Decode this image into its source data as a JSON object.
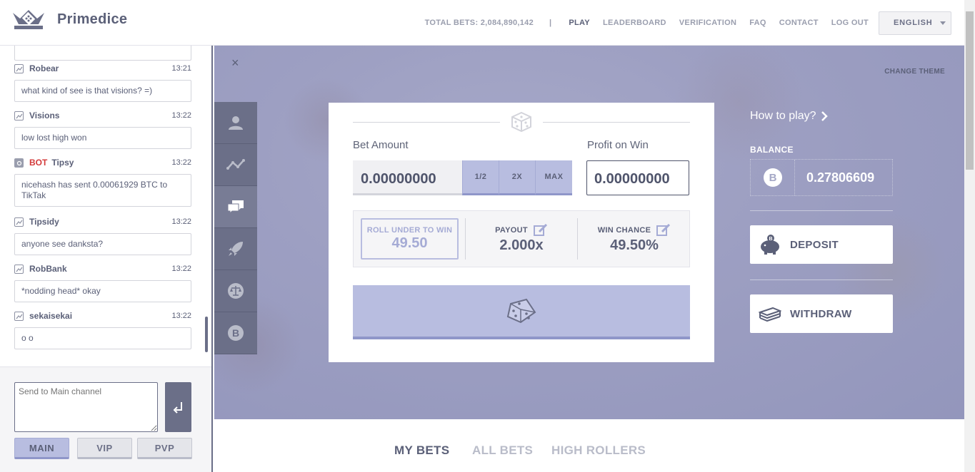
{
  "header": {
    "brand": "Primedice",
    "total_bets": "TOTAL BETS: 2,084,890,142",
    "separator": "|",
    "nav": [
      "PLAY",
      "LEADERBOARD",
      "VERIFICATION",
      "FAQ",
      "CONTACT",
      "LOG OUT"
    ],
    "language": "ENGLISH"
  },
  "chat": {
    "messages": [
      {
        "user": "Robear",
        "time": "13:21",
        "text": "what kind of see is that visions? =)"
      },
      {
        "user": "Visions",
        "time": "13:22",
        "text": "low lost high won"
      },
      {
        "bot": "BOT",
        "user": "Tipsy",
        "time": "13:22",
        "text": "nicehash has sent 0.00061929 BTC to TikTak"
      },
      {
        "user": "Tipsidy",
        "time": "13:22",
        "text": "anyone see danksta?"
      },
      {
        "user": "RobBank",
        "time": "13:22",
        "text": "*nodding head* okay"
      },
      {
        "user": "sekaisekai",
        "time": "13:22",
        "text": "o o"
      }
    ],
    "input_placeholder": "Send to Main channel",
    "channels": [
      "MAIN",
      "VIP",
      "PVP"
    ],
    "active_channel": "MAIN"
  },
  "stage": {
    "close": "×",
    "change_theme": "CHANGE THEME",
    "sidebar_icons": [
      "user-icon",
      "stats-icon",
      "chat-icon",
      "rocket-icon",
      "scales-icon",
      "bitcoin-icon"
    ],
    "bet_amount_label": "Bet Amount",
    "bet_amount": "0.00000000",
    "bet_buttons": [
      "1/2",
      "2X",
      "MAX"
    ],
    "profit_label": "Profit on Win",
    "profit": "0.00000000",
    "roll_label": "ROLL UNDER TO WIN",
    "roll_value": "49.50",
    "payout_label": "PAYOUT",
    "payout_value": "2.000x",
    "chance_label": "WIN CHANCE",
    "chance_value": "49.50%",
    "how_to_play": "How to play?",
    "balance_label": "BALANCE",
    "balance": "0.27806609",
    "deposit": "DEPOSIT",
    "withdraw": "WITHDRAW"
  },
  "bottom_tabs": [
    "MY BETS",
    "ALL BETS",
    "HIGH ROLLERS"
  ],
  "colors": {
    "accent": "#b8bde0",
    "dark": "#6b6f88",
    "bot": "#d33a3a"
  }
}
